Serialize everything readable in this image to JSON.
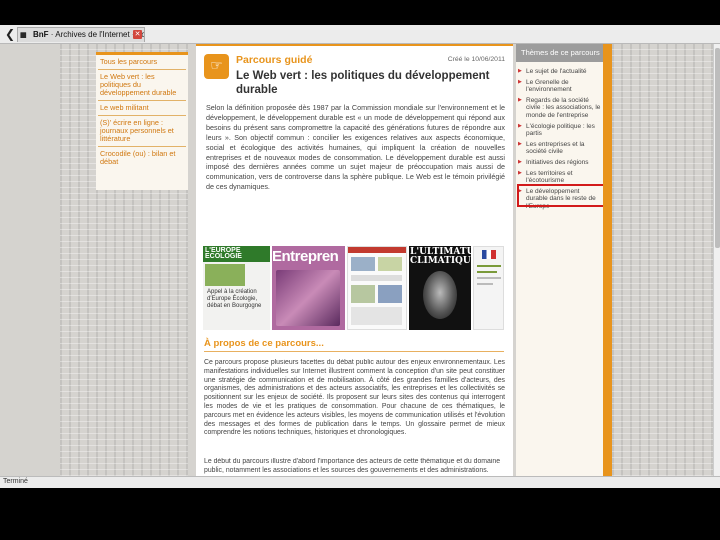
{
  "browser": {
    "tab_title_bold": "BnF",
    "tab_title": " · Archives de l'Internet · po...",
    "status_text": "Terminé"
  },
  "left_nav": {
    "items": [
      "Tous les parcours",
      "Le Web vert : les politiques du développement durable",
      "Le web militant",
      "(S)' écrire en ligne : journaux personnels et littérature",
      "Crocodile (ou) : bilan et débat"
    ]
  },
  "header": {
    "guide_label": "Parcours guidé",
    "date": "Créé le 10/06/2011",
    "title": "Le Web vert : les politiques du développement durable"
  },
  "intro_text": "Selon la définition proposée dès 1987 par la Commission mondiale sur l'environnement et le développement, le développement durable est « un mode de développement qui répond aux besoins du présent sans compromettre la capacité des générations futures de répondre aux leurs ». Son objectif commun : concilier les exigences relatives aux aspects économique, social et écologique des activités humaines, qui impliquent la création de nouvelles entreprises et de nouveaux modes de consommation. Le développement durable est aussi imposé des dernières années comme un sujet majeur de préoccupation mais aussi de communication, vers de controverse dans la sphère publique. Le Web est le témoin privilégié de ces dynamiques.",
  "thumbnails": {
    "t1_mast": "L'EUROPE ECOLOGIE",
    "t1_text": "Appel à la création d'Europe Écologie, débat en Bourgogne",
    "t2_head": "Entrepren",
    "t4_head": "L'ULTIMATUM CLIMATIQUE"
  },
  "section": {
    "title": "À propos de ce parcours...",
    "about_text": "Ce parcours propose plusieurs facettes du débat public autour des enjeux environnementaux. Les manifestations individuelles sur Internet illustrent comment la conception d'un site peut constituer une stratégie de communication et de mobilisation. À côté des grandes familles d'acteurs, des organismes, des administrations et des acteurs associatifs, les entreprises et les collectivités se positionnent sur les enjeux de société. Ils proposent sur leurs sites des contenus qui interrogent les modes de vie et les pratiques de consommation. Pour chacune de ces thématiques, le parcours met en évidence les acteurs visibles, les moyens de communication utilisés et l'évolution des messages et des formes de publication dans le temps. Un glossaire permet de mieux comprendre les notions techniques, historiques et chronologiques.",
    "about_text_2": "Le début du parcours illustre d'abord l'importance des acteurs de cette thématique et du domaine public, notamment les associations et les sources des gouvernements et des administrations."
  },
  "sidebar": {
    "heading": "Thèmes de ce parcours",
    "items": [
      "Le sujet de l'actualité",
      "Le Grenelle de l'environnement",
      "Regards de la société civile : les associations, le monde de l'entreprise",
      "L'écologie politique : les partis",
      "Les entreprises et la société civile",
      "Initiatives des régions",
      "Les territoires et l'écotourisme",
      "Le développement durable dans le reste de l'Europe"
    ]
  },
  "colors": {
    "accent": "#e8941c",
    "highlight": "#d21a1a"
  }
}
